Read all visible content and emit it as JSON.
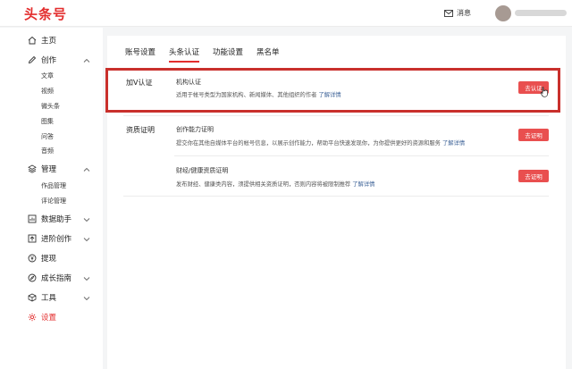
{
  "header": {
    "logo": "头条号",
    "messages_label": "消息"
  },
  "sidebar": {
    "home": "主页",
    "create": "创作",
    "create_items": [
      "文章",
      "视频",
      "微头条",
      "图集",
      "问答",
      "音频"
    ],
    "manage": "管理",
    "manage_items": [
      "作品管理",
      "评论管理"
    ],
    "data_assistant": "数据助手",
    "advanced_create": "进阶创作",
    "withdraw": "提现",
    "growth_guide": "成长指南",
    "tools": "工具",
    "settings": "设置"
  },
  "tabs": [
    "账号设置",
    "头条认证",
    "功能设置",
    "黑名单"
  ],
  "active_tab": "头条认证",
  "sections": {
    "v_cert": {
      "title": "加V认证",
      "item_title": "机构认证",
      "item_desc": "适用于帐号类型为国家机构、新闻媒体、其他组织的作者",
      "link": "了解详情",
      "button": "去认证"
    },
    "qualification": {
      "title": "资质证明",
      "items": [
        {
          "title": "创作能力证明",
          "desc": "提交你在其他自媒体平台的帐号信息，以展示创作能力，帮助平台快速发现你，为你提供更好的资源和服务",
          "link": "了解详情",
          "button": "去证明"
        },
        {
          "title": "财经/健康资质证明",
          "desc": "发布财经、健康类内容，须提供相关资质证明，否则内容将被限制推荐",
          "link": "了解详情",
          "button": "去证明"
        }
      ]
    }
  },
  "colors": {
    "brand": "#e32d2d",
    "button": "#e94f4f",
    "highlight_border": "#c9302c",
    "link": "#406599"
  }
}
